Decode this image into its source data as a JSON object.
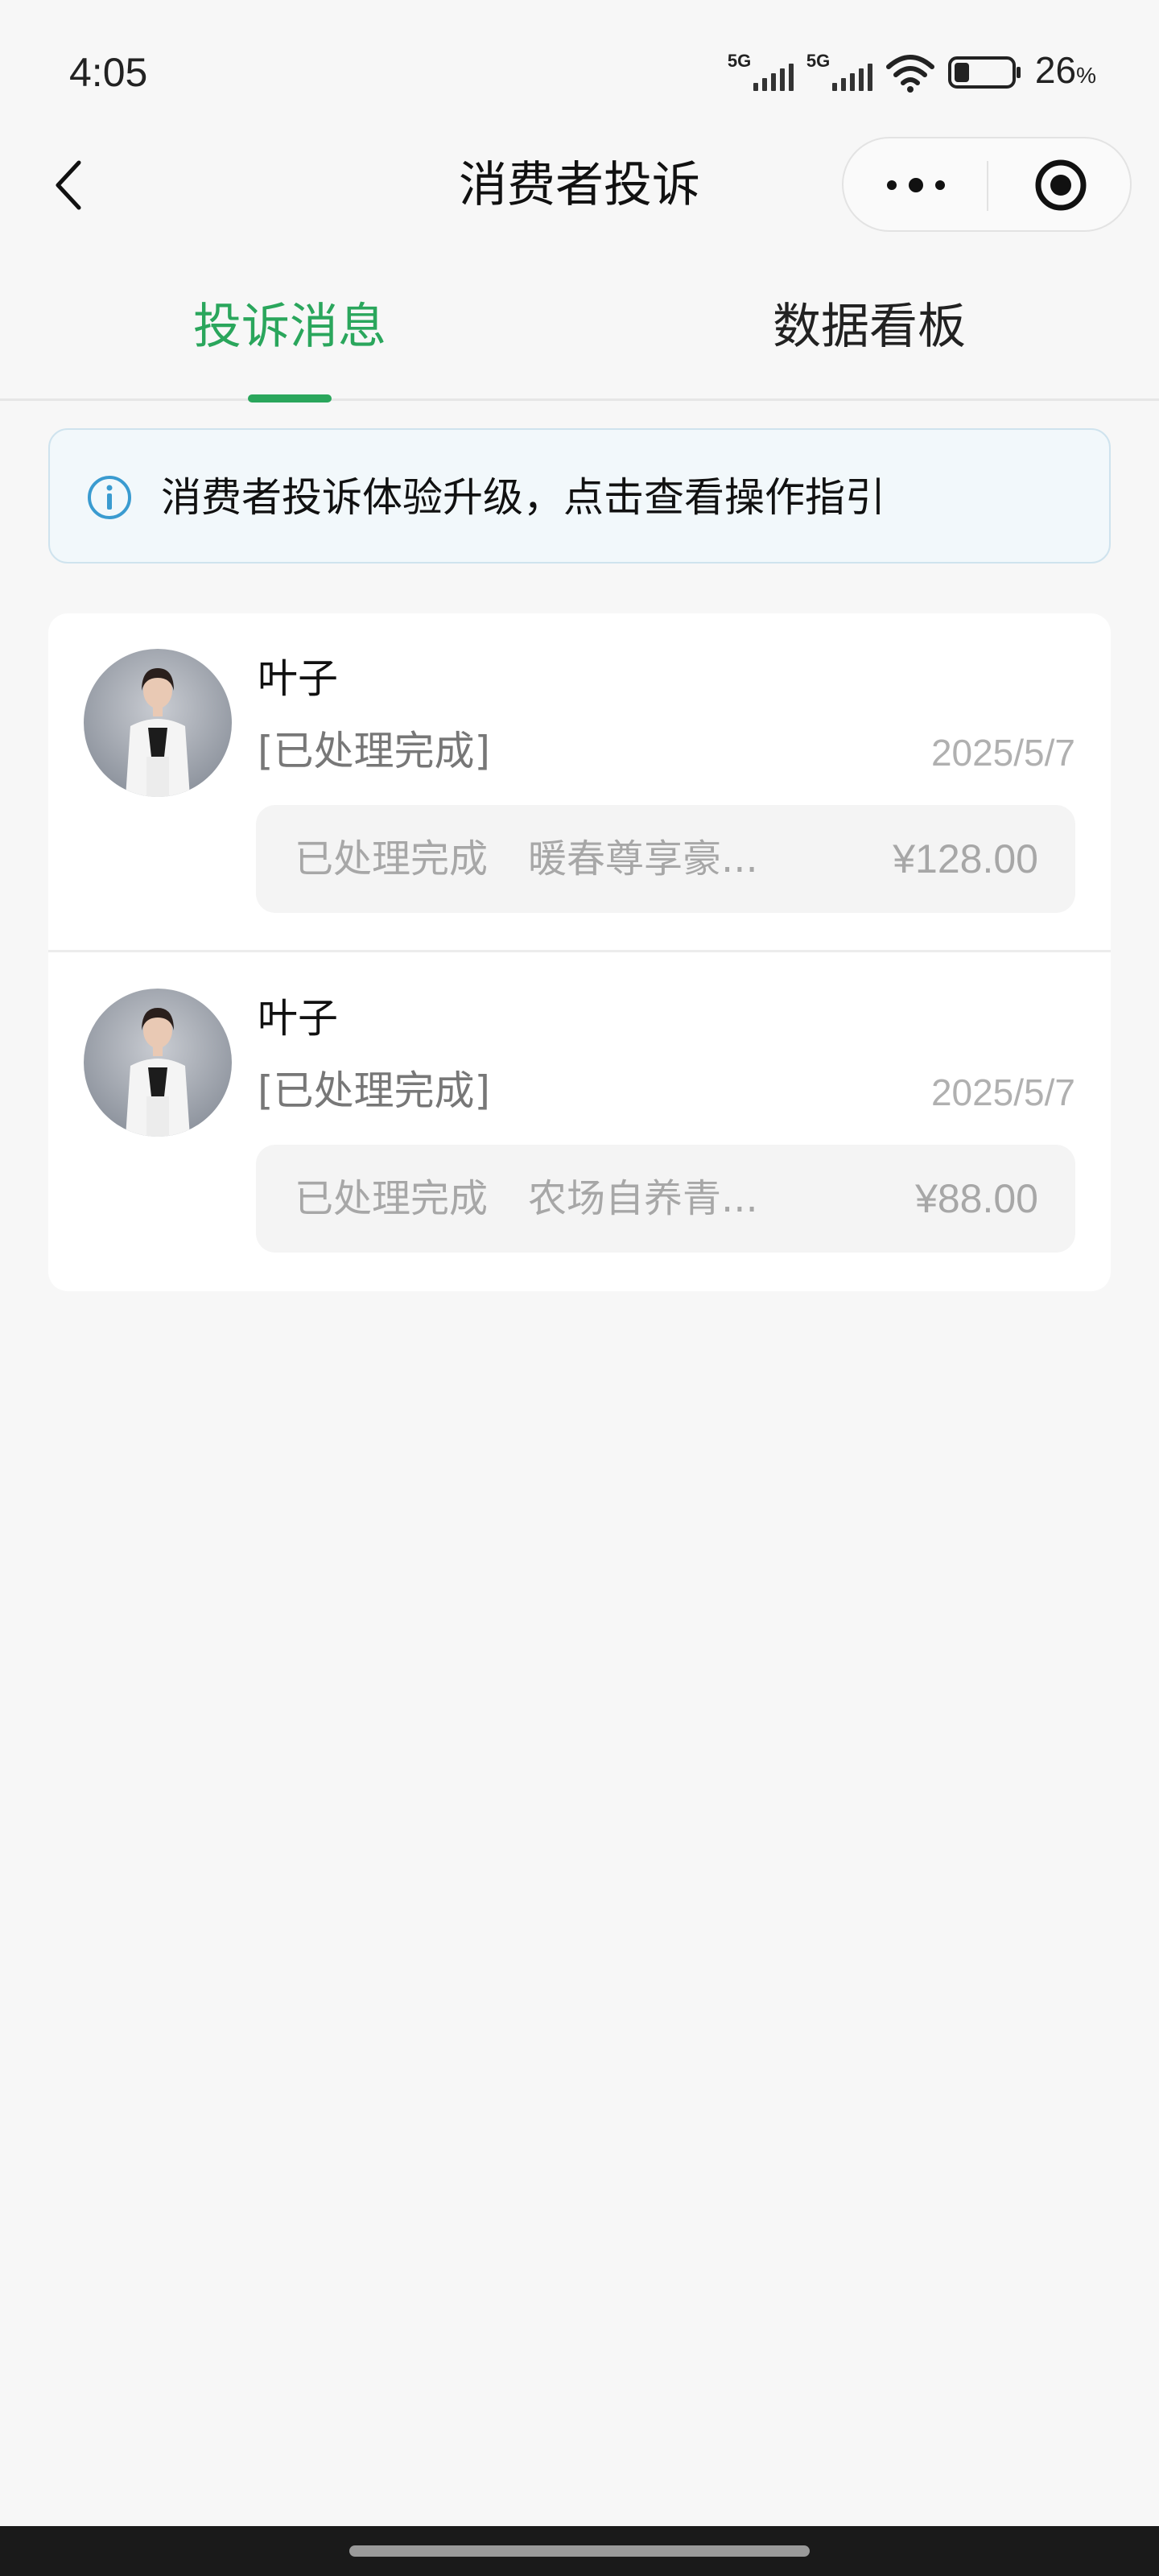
{
  "status_bar": {
    "time": "4:05",
    "sim1_label": "5G",
    "sim2_label": "5G",
    "battery_value": "26",
    "battery_unit": "%",
    "battery_level": 0.26,
    "icons": [
      "signal-icon",
      "wifi-icon",
      "battery-icon"
    ]
  },
  "nav": {
    "title": "消费者投诉",
    "back_icon": "chevron-left-icon",
    "more_icon": "more-dots-icon",
    "close_icon": "target-circle-icon"
  },
  "tabs": [
    {
      "label": "投诉消息",
      "active": true
    },
    {
      "label": "数据看板",
      "active": false
    }
  ],
  "notice": {
    "icon": "info-icon",
    "text": "消费者投诉体验升级，点击查看操作指引"
  },
  "complaints": [
    {
      "name": "叶子",
      "status": "[已处理完成]",
      "date": "2025/5/7",
      "order_status": "已处理完成",
      "product": "暖春尊享豪...",
      "price": "¥128.00"
    },
    {
      "name": "叶子",
      "status": "[已处理完成]",
      "date": "2025/5/7",
      "order_status": "已处理完成",
      "product": "农场自养青...",
      "price": "¥88.00"
    }
  ],
  "colors": {
    "accent": "#2aa65c",
    "background": "#f7f7f7",
    "notice_bg": "#f2f8fb",
    "notice_icon": "#3a9bd0"
  }
}
